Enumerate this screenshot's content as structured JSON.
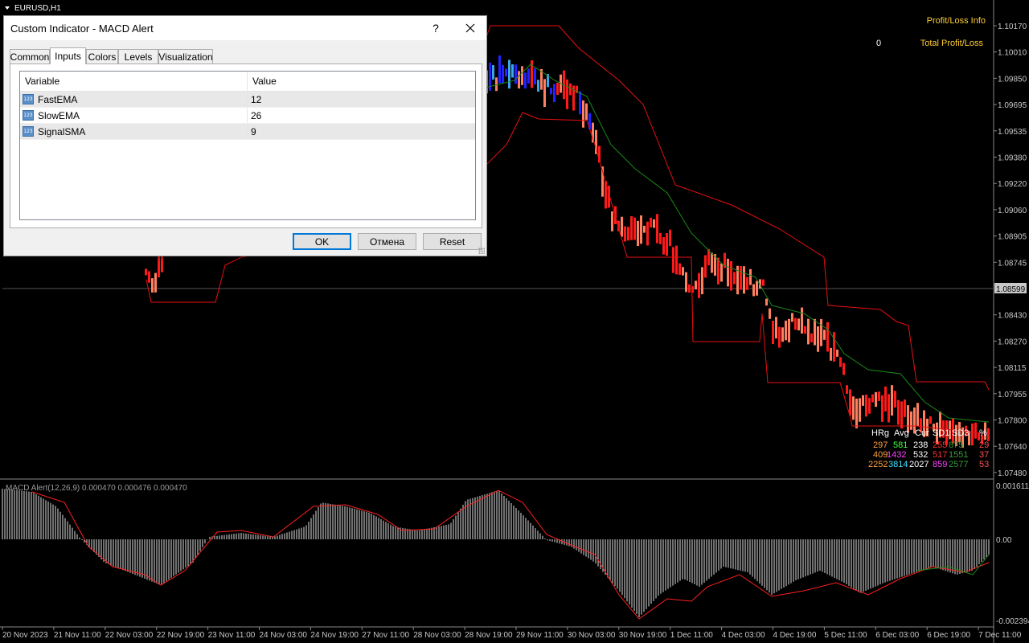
{
  "chart_header": {
    "symbol": "EURUSD,H1"
  },
  "pl_info": {
    "title": "Profit/Loss Info",
    "total_value": "0",
    "total_label": "Total Profit/Loss"
  },
  "price_axis": {
    "labels": [
      "1.10170",
      "1.10010",
      "1.09850",
      "1.09695",
      "1.09535",
      "1.09380",
      "1.09220",
      "1.09060",
      "1.08905",
      "1.08745",
      "1.08599",
      "1.08430",
      "1.08270",
      "1.08115",
      "1.07955",
      "1.07800",
      "1.07640",
      "1.07480"
    ],
    "current": "1.08599"
  },
  "macd": {
    "label": "MACD Alert(12,26,9) 0.000470 0.000476 0.000470",
    "axis_top": "0.001611",
    "axis_zero": "0.00",
    "axis_bottom": "-0.002394"
  },
  "time_axis": [
    "20 Nov 2023",
    "21 Nov 11:00",
    "22 Nov 03:00",
    "22 Nov 19:00",
    "23 Nov 11:00",
    "24 Nov 03:00",
    "24 Nov 19:00",
    "27 Nov 11:00",
    "28 Nov 03:00",
    "28 Nov 19:00",
    "29 Nov 11:00",
    "30 Nov 03:00",
    "30 Nov 19:00",
    "1 Dec 11:00",
    "4 Dec 03:00",
    "4 Dec 19:00",
    "5 Dec 11:00",
    "6 Dec 03:00",
    "6 Dec 19:00",
    "7 Dec 11:00"
  ],
  "stats": {
    "headers": [
      "HRg",
      "Avg",
      "Cur",
      "SD1",
      "SD3",
      "%"
    ],
    "rows": [
      [
        "297",
        "581",
        "238",
        "255",
        "875",
        "29"
      ],
      [
        "409",
        "1432",
        "532",
        "517",
        "1551",
        "37"
      ],
      [
        "2252",
        "3814",
        "2027",
        "859",
        "2577",
        "53"
      ]
    ]
  },
  "dialog": {
    "title": "Custom Indicator - MACD Alert",
    "help": "?",
    "tabs": [
      "Common",
      "Inputs",
      "Colors",
      "Levels",
      "Visualization"
    ],
    "active_tab": 1,
    "columns": [
      "Variable",
      "Value"
    ],
    "params": [
      {
        "name": "FastEMA",
        "value": "12",
        "icon": "123"
      },
      {
        "name": "SlowEMA",
        "value": "26",
        "icon": "123"
      },
      {
        "name": "SignalSMA",
        "value": "9",
        "icon": "123"
      }
    ],
    "buttons": {
      "ok": "OK",
      "cancel": "Отмена",
      "reset": "Reset"
    }
  },
  "colors": {
    "bull": "#3ba7e8",
    "bull_dark": "#2222ff",
    "bear": "#ff1a1a",
    "bear_light": "#ff8060",
    "signal": "#ff2020",
    "ma": "#1a8a1a",
    "accent": "#ffcc33"
  }
}
